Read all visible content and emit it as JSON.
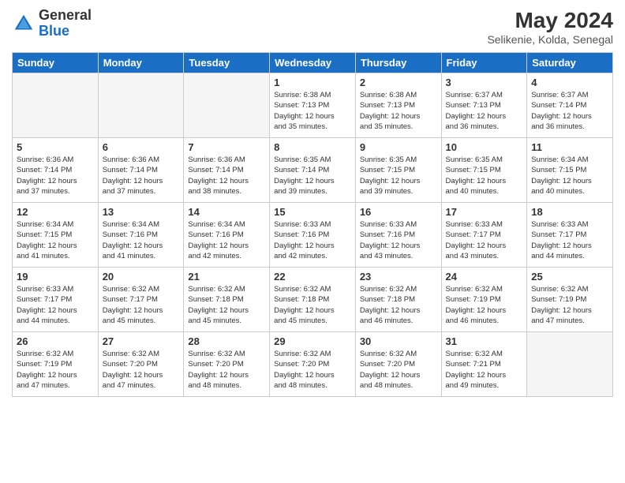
{
  "header": {
    "logo_general": "General",
    "logo_blue": "Blue",
    "month_year": "May 2024",
    "location": "Selikenie, Kolda, Senegal"
  },
  "days_of_week": [
    "Sunday",
    "Monday",
    "Tuesday",
    "Wednesday",
    "Thursday",
    "Friday",
    "Saturday"
  ],
  "weeks": [
    [
      {
        "day": "",
        "info": ""
      },
      {
        "day": "",
        "info": ""
      },
      {
        "day": "",
        "info": ""
      },
      {
        "day": "1",
        "info": "Sunrise: 6:38 AM\nSunset: 7:13 PM\nDaylight: 12 hours\nand 35 minutes."
      },
      {
        "day": "2",
        "info": "Sunrise: 6:38 AM\nSunset: 7:13 PM\nDaylight: 12 hours\nand 35 minutes."
      },
      {
        "day": "3",
        "info": "Sunrise: 6:37 AM\nSunset: 7:13 PM\nDaylight: 12 hours\nand 36 minutes."
      },
      {
        "day": "4",
        "info": "Sunrise: 6:37 AM\nSunset: 7:14 PM\nDaylight: 12 hours\nand 36 minutes."
      }
    ],
    [
      {
        "day": "5",
        "info": "Sunrise: 6:36 AM\nSunset: 7:14 PM\nDaylight: 12 hours\nand 37 minutes."
      },
      {
        "day": "6",
        "info": "Sunrise: 6:36 AM\nSunset: 7:14 PM\nDaylight: 12 hours\nand 37 minutes."
      },
      {
        "day": "7",
        "info": "Sunrise: 6:36 AM\nSunset: 7:14 PM\nDaylight: 12 hours\nand 38 minutes."
      },
      {
        "day": "8",
        "info": "Sunrise: 6:35 AM\nSunset: 7:14 PM\nDaylight: 12 hours\nand 39 minutes."
      },
      {
        "day": "9",
        "info": "Sunrise: 6:35 AM\nSunset: 7:15 PM\nDaylight: 12 hours\nand 39 minutes."
      },
      {
        "day": "10",
        "info": "Sunrise: 6:35 AM\nSunset: 7:15 PM\nDaylight: 12 hours\nand 40 minutes."
      },
      {
        "day": "11",
        "info": "Sunrise: 6:34 AM\nSunset: 7:15 PM\nDaylight: 12 hours\nand 40 minutes."
      }
    ],
    [
      {
        "day": "12",
        "info": "Sunrise: 6:34 AM\nSunset: 7:15 PM\nDaylight: 12 hours\nand 41 minutes."
      },
      {
        "day": "13",
        "info": "Sunrise: 6:34 AM\nSunset: 7:16 PM\nDaylight: 12 hours\nand 41 minutes."
      },
      {
        "day": "14",
        "info": "Sunrise: 6:34 AM\nSunset: 7:16 PM\nDaylight: 12 hours\nand 42 minutes."
      },
      {
        "day": "15",
        "info": "Sunrise: 6:33 AM\nSunset: 7:16 PM\nDaylight: 12 hours\nand 42 minutes."
      },
      {
        "day": "16",
        "info": "Sunrise: 6:33 AM\nSunset: 7:16 PM\nDaylight: 12 hours\nand 43 minutes."
      },
      {
        "day": "17",
        "info": "Sunrise: 6:33 AM\nSunset: 7:17 PM\nDaylight: 12 hours\nand 43 minutes."
      },
      {
        "day": "18",
        "info": "Sunrise: 6:33 AM\nSunset: 7:17 PM\nDaylight: 12 hours\nand 44 minutes."
      }
    ],
    [
      {
        "day": "19",
        "info": "Sunrise: 6:33 AM\nSunset: 7:17 PM\nDaylight: 12 hours\nand 44 minutes."
      },
      {
        "day": "20",
        "info": "Sunrise: 6:32 AM\nSunset: 7:17 PM\nDaylight: 12 hours\nand 45 minutes."
      },
      {
        "day": "21",
        "info": "Sunrise: 6:32 AM\nSunset: 7:18 PM\nDaylight: 12 hours\nand 45 minutes."
      },
      {
        "day": "22",
        "info": "Sunrise: 6:32 AM\nSunset: 7:18 PM\nDaylight: 12 hours\nand 45 minutes."
      },
      {
        "day": "23",
        "info": "Sunrise: 6:32 AM\nSunset: 7:18 PM\nDaylight: 12 hours\nand 46 minutes."
      },
      {
        "day": "24",
        "info": "Sunrise: 6:32 AM\nSunset: 7:19 PM\nDaylight: 12 hours\nand 46 minutes."
      },
      {
        "day": "25",
        "info": "Sunrise: 6:32 AM\nSunset: 7:19 PM\nDaylight: 12 hours\nand 47 minutes."
      }
    ],
    [
      {
        "day": "26",
        "info": "Sunrise: 6:32 AM\nSunset: 7:19 PM\nDaylight: 12 hours\nand 47 minutes."
      },
      {
        "day": "27",
        "info": "Sunrise: 6:32 AM\nSunset: 7:20 PM\nDaylight: 12 hours\nand 47 minutes."
      },
      {
        "day": "28",
        "info": "Sunrise: 6:32 AM\nSunset: 7:20 PM\nDaylight: 12 hours\nand 48 minutes."
      },
      {
        "day": "29",
        "info": "Sunrise: 6:32 AM\nSunset: 7:20 PM\nDaylight: 12 hours\nand 48 minutes."
      },
      {
        "day": "30",
        "info": "Sunrise: 6:32 AM\nSunset: 7:20 PM\nDaylight: 12 hours\nand 48 minutes."
      },
      {
        "day": "31",
        "info": "Sunrise: 6:32 AM\nSunset: 7:21 PM\nDaylight: 12 hours\nand 49 minutes."
      },
      {
        "day": "",
        "info": ""
      }
    ]
  ]
}
